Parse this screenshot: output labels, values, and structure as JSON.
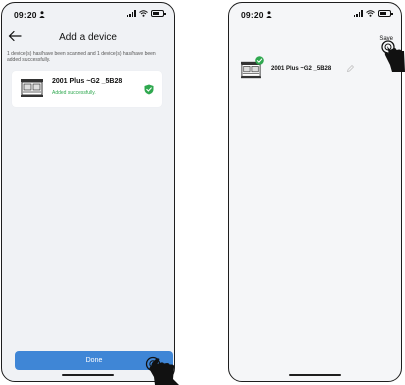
{
  "left_phone": {
    "status": {
      "time": "09:20"
    },
    "header": {
      "title": "Add a device"
    },
    "info_text": "1 device(s) has/have been scanned and 1 device(s) has/have been added successfully.",
    "device": {
      "name": "2001 Plus ~G2 _5B28",
      "status": "Added successfully."
    },
    "done_button": "Done"
  },
  "right_phone": {
    "status": {
      "time": "09:20"
    },
    "save_label": "Save",
    "device": {
      "name": "2001 Plus ~G2 _5B28"
    }
  },
  "colors": {
    "accent": "#3f86d6",
    "success": "#2fa84f"
  },
  "icons": [
    "back-arrow-icon",
    "generator-icon",
    "shield-check-icon",
    "pencil-icon",
    "check-badge-icon",
    "hand-pointer-icon",
    "signal-icon",
    "wifi-icon",
    "battery-icon"
  ]
}
